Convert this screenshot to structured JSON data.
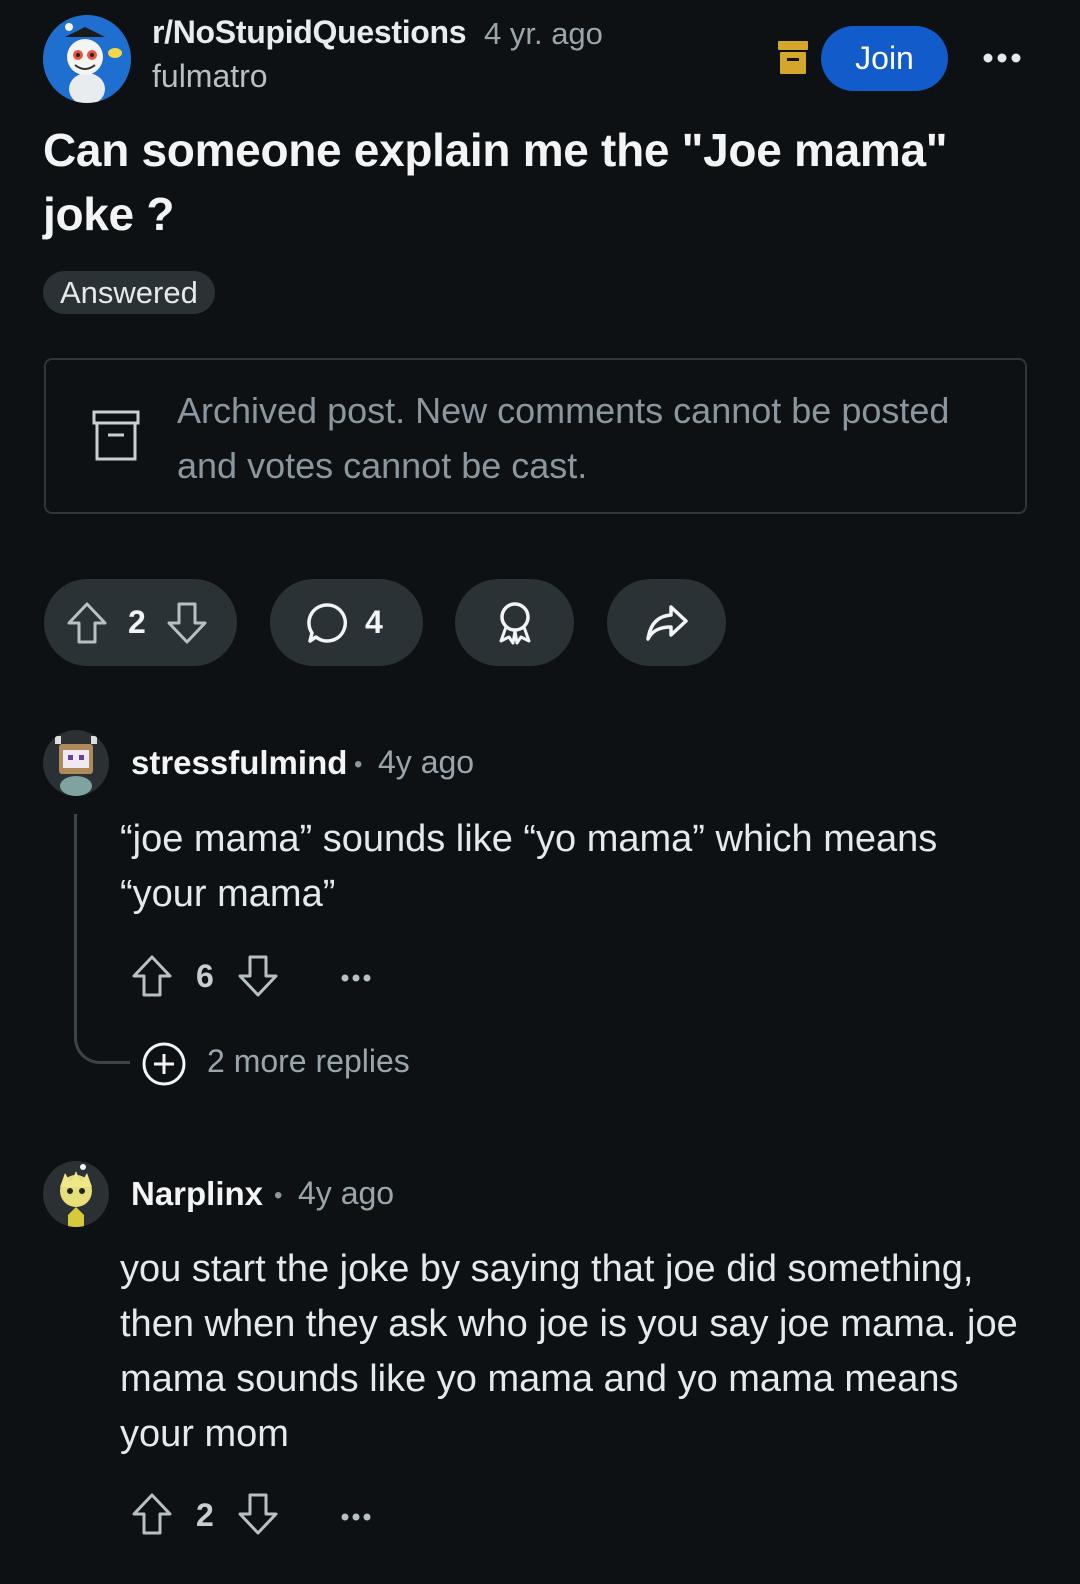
{
  "post": {
    "subreddit": "r/NoStupidQuestions",
    "age": "4 yr. ago",
    "author": "fulmatro",
    "join_label": "Join",
    "title": "Can someone explain me the \"Joe mama\" joke ?",
    "flair": "Answered",
    "archived_notice": "Archived post. New comments cannot be posted and votes cannot be cast.",
    "score": "2",
    "comment_count": "4"
  },
  "comments": [
    {
      "user": "stressfulmind",
      "dot": "•",
      "age": "4y ago",
      "body": "“joe mama” sounds like “yo mama” which means “your mama”",
      "score": "6",
      "more_replies": "2 more replies"
    },
    {
      "user": "Narplinx",
      "dot": "•",
      "age": "4y ago",
      "body": "you start the joke by saying that joe did something, then when they ask who joe is you say joe mama. joe mama sounds like yo mama and yo mama means your mom",
      "score": "2"
    }
  ],
  "icons": {
    "archive": "archive-icon",
    "more": "more-horizontal-icon",
    "upvote": "upvote-arrow-icon",
    "downvote": "downvote-arrow-icon",
    "comment": "comment-bubble-icon",
    "award": "award-icon",
    "share": "share-arrow-icon",
    "expand": "plus-circle-icon"
  },
  "colors": {
    "background": "#0e1113",
    "join_button": "#115bca",
    "archive_badge": "#d4a72c",
    "pill": "#2a3236"
  }
}
